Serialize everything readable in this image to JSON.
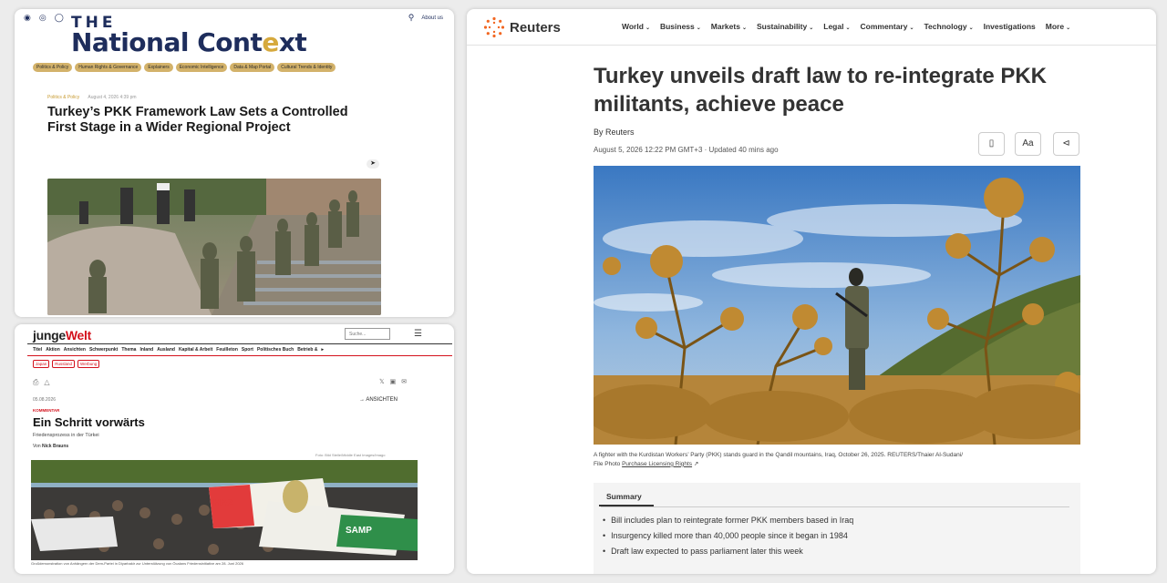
{
  "national_context": {
    "about_label": "About us",
    "logo_the": "THE",
    "logo_name_a": "National Cont",
    "logo_name_b": "e",
    "logo_name_c": "xt",
    "categories": [
      "Politics & Policy",
      "Human Rights & Governance",
      "Explainers",
      "Economic Intelligence",
      "Data & Map Portal",
      "Cultural Trends & Identity"
    ],
    "meta_category": "Politics & Policy",
    "meta_date": "August 4, 2026 4:39 pm",
    "title": "Turkey’s PKK Framework Law Sets a Controlled First Stage in a Wider Regional Project",
    "icons": [
      "dot-icon",
      "circle-icon",
      "globe-icon",
      "search-icon",
      "share-icon"
    ]
  },
  "junge_welt": {
    "logo_a": "junge",
    "logo_b": "Welt",
    "search_placeholder": "Suche...",
    "nav": [
      "Titel",
      "Aktion",
      "Ansichten",
      "Schwerpunkt",
      "Thema",
      "Inland",
      "Ausland",
      "Kapital & Arbeit",
      "Feuilleton",
      "Sport",
      "Politisches Buch",
      "Betrieb &"
    ],
    "tags": [
      "Japan",
      "Russland",
      "Werbung"
    ],
    "date": "05.08.2026",
    "ansichten": "ANSICHTEN",
    "kicker": "KOMMENTAR",
    "title": "Ein Schritt vorwärts",
    "subtitle": "Friedensprozess in der Türkei",
    "author_prefix": "Von",
    "author": "Nick Brauns",
    "photo_credit": "Foto: Bild Stelle/Middle East Images/Imago",
    "caption": "Großdemonstration von Anhängern der Dem-Partei in Diyarbakir zur Unterstützung von Öcalans Friedensinitiative am 28. Juni 2026",
    "banner_texts": [
      "HAZ",
      "SAMP"
    ]
  },
  "reuters": {
    "logo": "Reuters",
    "nav": [
      "World",
      "Business",
      "Markets",
      "Sustainability",
      "Legal",
      "Commentary",
      "Technology",
      "Investigations",
      "More"
    ],
    "nav_has_chevron": [
      true,
      true,
      true,
      true,
      true,
      true,
      true,
      false,
      true
    ],
    "title": "Turkey unveils draft law to re-integrate PKK militants, achieve peace",
    "byline": "By Reuters",
    "date": "August 5, 2026 12:22 PM GMT+3 · Updated 40 mins ago",
    "caption": "A fighter with the Kurdistan Workers’ Party (PKK) stands guard in the Qandil mountains, Iraq, October 26, 2025. REUTERS/Thaier Al-Sudani/",
    "caption_line2_prefix": "File Photo",
    "caption_link": "Purchase Licensing Rights",
    "summary_tab": "Summary",
    "summary": [
      "Bill includes plan to reintegrate former PKK members based in Iraq",
      "Insurgency killed more than 40,000 people since it began in 1984",
      "Draft law expected to pass parliament later this week"
    ],
    "buttons": [
      "bookmark-icon",
      "text-size-icon",
      "share-icon"
    ],
    "text_size_label": "Aa"
  }
}
